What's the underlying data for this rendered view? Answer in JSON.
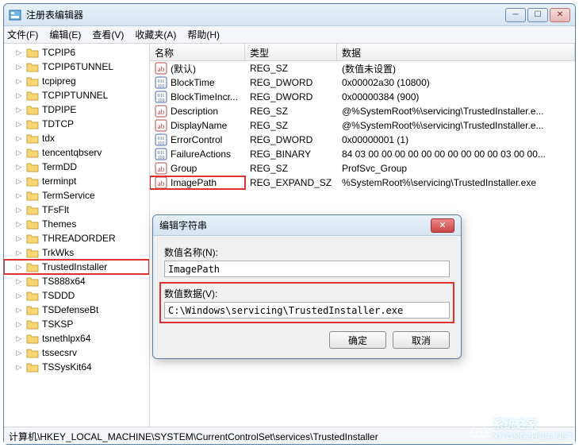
{
  "window": {
    "title": "注册表编辑器",
    "min_tip": "最小化",
    "max_tip": "最大化",
    "close_tip": "关闭"
  },
  "menu": {
    "file": "文件(F)",
    "edit": "编辑(E)",
    "view": "查看(V)",
    "fav": "收藏夹(A)",
    "help": "帮助(H)"
  },
  "tree": {
    "items": [
      {
        "label": "TCPIP6"
      },
      {
        "label": "TCPIP6TUNNEL"
      },
      {
        "label": "tcpipreg"
      },
      {
        "label": "TCPIPTUNNEL"
      },
      {
        "label": "TDPIPE"
      },
      {
        "label": "TDTCP"
      },
      {
        "label": "tdx"
      },
      {
        "label": "tencentqbserv"
      },
      {
        "label": "TermDD"
      },
      {
        "label": "terminpt"
      },
      {
        "label": "TermService"
      },
      {
        "label": "TFsFlt"
      },
      {
        "label": "Themes"
      },
      {
        "label": "THREADORDER"
      },
      {
        "label": "TrkWks"
      },
      {
        "label": "TrustedInstaller",
        "highlight": true
      },
      {
        "label": "TS888x64"
      },
      {
        "label": "TSDDD"
      },
      {
        "label": "TSDefenseBt"
      },
      {
        "label": "TSKSP"
      },
      {
        "label": "tsnethlpx64"
      },
      {
        "label": "tssecsrv"
      },
      {
        "label": "TSSysKit64"
      }
    ]
  },
  "list": {
    "cols": {
      "name": "名称",
      "type": "类型",
      "data": "数据"
    },
    "rows": [
      {
        "kind": "sz",
        "name": "(默认)",
        "type": "REG_SZ",
        "data": "(数值未设置)"
      },
      {
        "kind": "bin",
        "name": "BlockTime",
        "type": "REG_DWORD",
        "data": "0x00002a30 (10800)"
      },
      {
        "kind": "bin",
        "name": "BlockTimeIncr...",
        "type": "REG_DWORD",
        "data": "0x00000384 (900)"
      },
      {
        "kind": "sz",
        "name": "Description",
        "type": "REG_SZ",
        "data": "@%SystemRoot%\\servicing\\TrustedInstaller.e..."
      },
      {
        "kind": "sz",
        "name": "DisplayName",
        "type": "REG_SZ",
        "data": "@%SystemRoot%\\servicing\\TrustedInstaller.e..."
      },
      {
        "kind": "bin",
        "name": "ErrorControl",
        "type": "REG_DWORD",
        "data": "0x00000001 (1)"
      },
      {
        "kind": "bin",
        "name": "FailureActions",
        "type": "REG_BINARY",
        "data": "84 03 00 00 00 00 00 00 00 00 00 00 03 00 00..."
      },
      {
        "kind": "sz",
        "name": "Group",
        "type": "REG_SZ",
        "data": "ProfSvc_Group"
      },
      {
        "kind": "sz",
        "name": "ImagePath",
        "type": "REG_EXPAND_SZ",
        "data": "%SystemRoot%\\servicing\\TrustedInstaller.exe",
        "highlight": true
      }
    ]
  },
  "statusbar": {
    "path": "计算机\\HKEY_LOCAL_MACHINE\\SYSTEM\\CurrentControlSet\\services\\TrustedInstaller"
  },
  "dialog": {
    "title": "编辑字符串",
    "name_label": "数值名称(N):",
    "name_value": "ImagePath",
    "data_label": "数值数据(V):",
    "data_value": "C:\\Windows\\servicing\\TrustedInstaller.exe",
    "ok": "确定",
    "cancel": "取消"
  },
  "watermark": {
    "text": "系统之家",
    "url": "XITONGZHIJIA.NET"
  }
}
